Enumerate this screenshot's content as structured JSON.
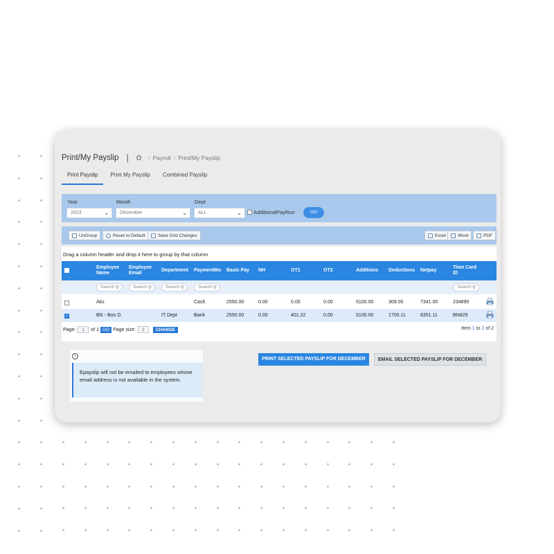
{
  "header": {
    "page_title": "Print/My Payslip",
    "title_separator": "|",
    "breadcrumb": [
      "Payroll",
      "Print/My Payslip"
    ],
    "home_icon": "home-icon"
  },
  "tabs": [
    {
      "label": "Print Payslip",
      "active": true
    },
    {
      "label": "Print My Payslip",
      "active": false
    },
    {
      "label": "Combined Payslip",
      "active": false
    }
  ],
  "filters": {
    "year_label": "Year",
    "year_value": "2023",
    "month_label": "Month",
    "month_value": "December",
    "dept_label": "Dept",
    "dept_value": "ALL",
    "additional_label": "AdditionalPayRun",
    "go_label": "GO"
  },
  "toolbar": {
    "ungroup": "UnGroup",
    "reset": "Reset to Default",
    "save": "Save Grid Changes",
    "excel": "Excel",
    "word": "Word",
    "pdf": "PDF"
  },
  "grid": {
    "group_hint": "Drag a column header and drop it here to group by that column",
    "columns": {
      "employee_name": "Employee Name",
      "employee_email": "Employee Email",
      "department": "Department",
      "payment_mode": "PaymentMo",
      "basic_pay": "Basic Pay",
      "nh": "NH",
      "ot1": "OT1",
      "ot2": "OT2",
      "additions": "Additions",
      "deductions": "Deductions",
      "netpay": "Netpay",
      "time_card_id": "Time Card ID"
    },
    "search_placeholder": "Search",
    "rows": [
      {
        "selected": false,
        "name": "Aks",
        "email": "",
        "dept": "",
        "payment": "Cash",
        "basic": "2550.00",
        "nh": "0.00",
        "ot1": "0.00",
        "ot2": "0.00",
        "additions": "5100.00",
        "deductions": "309.00",
        "netpay": "7341.00",
        "tcid": "234890"
      },
      {
        "selected": true,
        "name": "BN - Bon D.",
        "email": "",
        "dept": "IT Dept",
        "payment": "Bank",
        "basic": "2550.00",
        "nh": "0.00",
        "ot1": "401.22",
        "ot2": "0.00",
        "additions": "5100.00",
        "deductions": "1700.11",
        "netpay": "6351.11",
        "tcid": "BN829"
      }
    ]
  },
  "pager": {
    "page_label": "Page:",
    "page_value": "1",
    "of_label": "of 1",
    "go_label": "GO",
    "size_label": "Page size:",
    "size_value": "2",
    "change_label": "CHANGE",
    "items_prefix": "Item",
    "items_from": "1",
    "items_mid": "to",
    "items_to": "2",
    "items_of": "of 2"
  },
  "info": {
    "message": "Epayslip will not be emailed to employees whose email address is not available in the system."
  },
  "actions": {
    "print_label": "PRINT SELECTED PAYSLIP FOR DECEMBER",
    "email_label": "EMAIL SELECTED PAYSLIP FOR DECEMBER"
  },
  "colors": {
    "accent": "#2a86e0",
    "panel": "#a9c9ec",
    "card": "#ebebeb"
  }
}
